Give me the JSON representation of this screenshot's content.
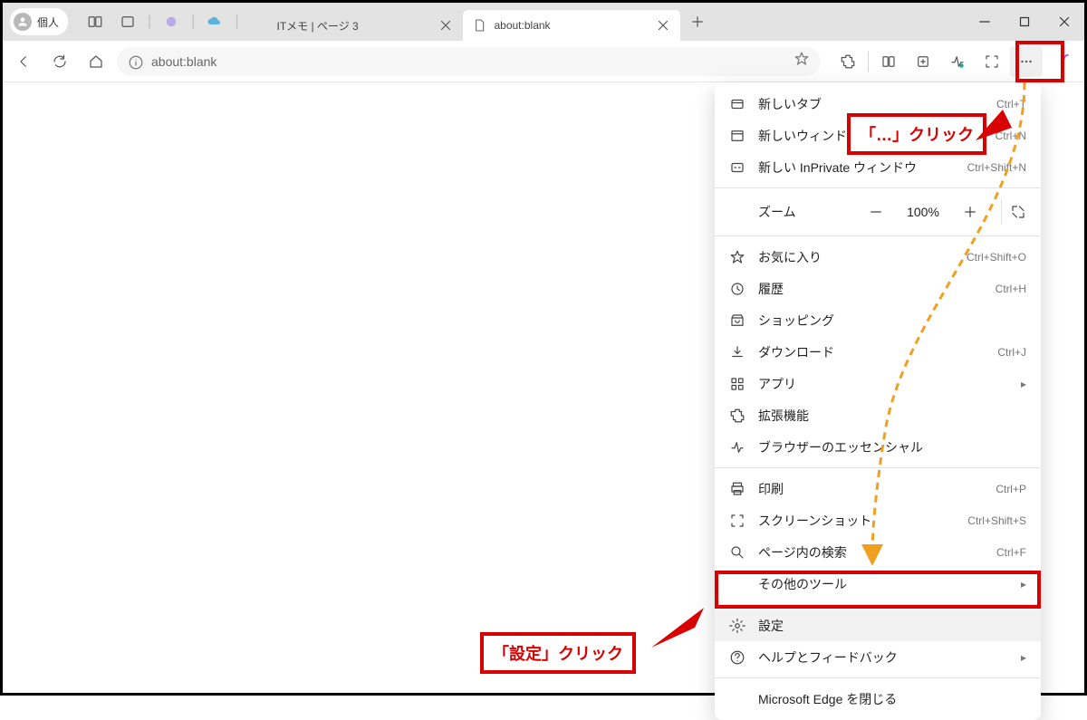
{
  "profile": {
    "label": "個人"
  },
  "tabs": [
    {
      "label": "ITメモ | ページ 3",
      "active": false
    },
    {
      "label": "about:blank",
      "active": true
    }
  ],
  "address": {
    "text": "about:blank"
  },
  "menu": {
    "items_top": [
      {
        "icon": "tab",
        "label": "新しいタブ",
        "shortcut": "Ctrl+T"
      },
      {
        "icon": "window",
        "label": "新しいウィンドウ",
        "shortcut": "Ctrl+N"
      },
      {
        "icon": "inprivate",
        "label": "新しい InPrivate ウィンドウ",
        "shortcut": "Ctrl+Shift+N"
      }
    ],
    "zoom": {
      "label": "ズーム",
      "value": "100%"
    },
    "items_mid": [
      {
        "icon": "fav",
        "label": "お気に入り",
        "shortcut": "Ctrl+Shift+O"
      },
      {
        "icon": "history",
        "label": "履歴",
        "shortcut": "Ctrl+H"
      },
      {
        "icon": "shopping",
        "label": "ショッピング",
        "shortcut": ""
      },
      {
        "icon": "download",
        "label": "ダウンロード",
        "shortcut": "Ctrl+J"
      },
      {
        "icon": "apps",
        "label": "アプリ",
        "shortcut": "",
        "sub": "▸"
      },
      {
        "icon": "ext",
        "label": "拡張機能",
        "shortcut": ""
      },
      {
        "icon": "essentials",
        "label": "ブラウザーのエッセンシャル",
        "shortcut": ""
      }
    ],
    "items_print": [
      {
        "icon": "print",
        "label": "印刷",
        "shortcut": "Ctrl+P"
      },
      {
        "icon": "screenshot",
        "label": "スクリーンショット",
        "shortcut": "Ctrl+Shift+S"
      },
      {
        "icon": "find",
        "label": "ページ内の検索",
        "shortcut": "Ctrl+F"
      },
      {
        "icon": "tools",
        "label": "その他のツール",
        "shortcut": "",
        "sub": "▸"
      }
    ],
    "items_bottom": [
      {
        "icon": "settings",
        "label": "設定",
        "shortcut": "",
        "highlight": true
      },
      {
        "icon": "help",
        "label": "ヘルプとフィードバック",
        "shortcut": "",
        "sub": "▸"
      }
    ],
    "close": {
      "label": "Microsoft Edge を閉じる"
    }
  },
  "annotations": {
    "more_click": "「…」クリック",
    "settings_click": "「設定」クリック"
  }
}
